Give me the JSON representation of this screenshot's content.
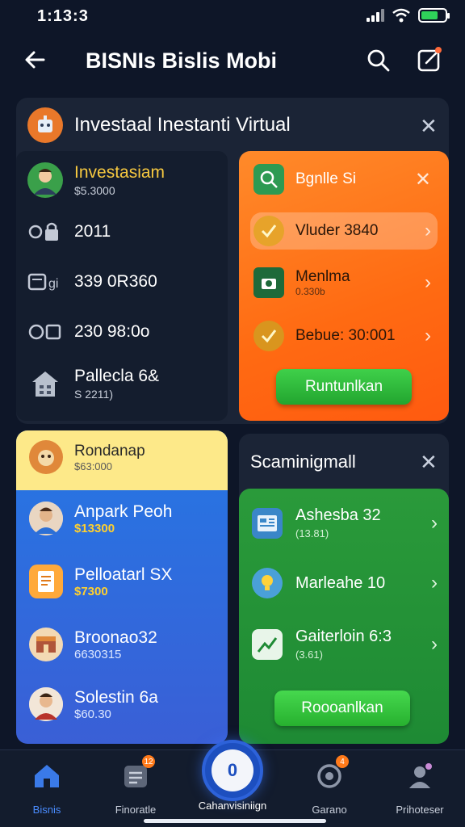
{
  "status_bar": {
    "time": "1:13:3"
  },
  "app_bar": {
    "title": "BISNIs Bislis Mobi"
  },
  "panel": {
    "title": "Investaal Inestanti Virtual",
    "left_items": [
      {
        "title": "Investasiam",
        "sub": "$5.3000"
      },
      {
        "title": "2011",
        "sub": ""
      },
      {
        "title": "339 0R360",
        "sub": ""
      },
      {
        "title": "230 98:0o",
        "sub": ""
      },
      {
        "title": "Pallecla 6&",
        "sub": "S 2211)"
      }
    ],
    "orange": {
      "items": [
        {
          "title": "Bgnlle Si",
          "sub": ""
        },
        {
          "title": "Vluder 3840",
          "sub": ""
        },
        {
          "title": "Menlma",
          "sub": "0.330b"
        },
        {
          "title": "Bebue: 30:001",
          "sub": ""
        }
      ],
      "button": "Runtunlkan"
    }
  },
  "promo": {
    "header": {
      "title": "Rondanap",
      "sub": "$63:000"
    },
    "items": [
      {
        "title": "Anpark Peoh",
        "sub": "$13300"
      },
      {
        "title": "Pelloatarl SX",
        "sub": "$7300"
      },
      {
        "title": "Broonao32",
        "sub": "6630315"
      },
      {
        "title": "Solestin 6a",
        "sub": "$60.30"
      }
    ]
  },
  "summary": {
    "title": "Scaminigmall",
    "items": [
      {
        "title": "Ashesba 32",
        "sub": "(13.81)"
      },
      {
        "title": "Marleahe 10",
        "sub": ""
      },
      {
        "title": "Gaiterloin 6:3",
        "sub": "(3.61)"
      }
    ],
    "button": "Roooanlkan"
  },
  "bottom_nav": {
    "items": [
      {
        "label": "Bisnis",
        "badge": ""
      },
      {
        "label": "Finoratle",
        "badge": "12"
      },
      {
        "label": "Garano",
        "badge": "4"
      },
      {
        "label": "Prihoteser",
        "badge": ""
      }
    ],
    "center_label": "Cahanvisiniign"
  },
  "colors": {
    "accent_blue": "#4a8cff",
    "orange": "#ff6a12",
    "green": "#22a52f",
    "gold": "#f7c940"
  }
}
